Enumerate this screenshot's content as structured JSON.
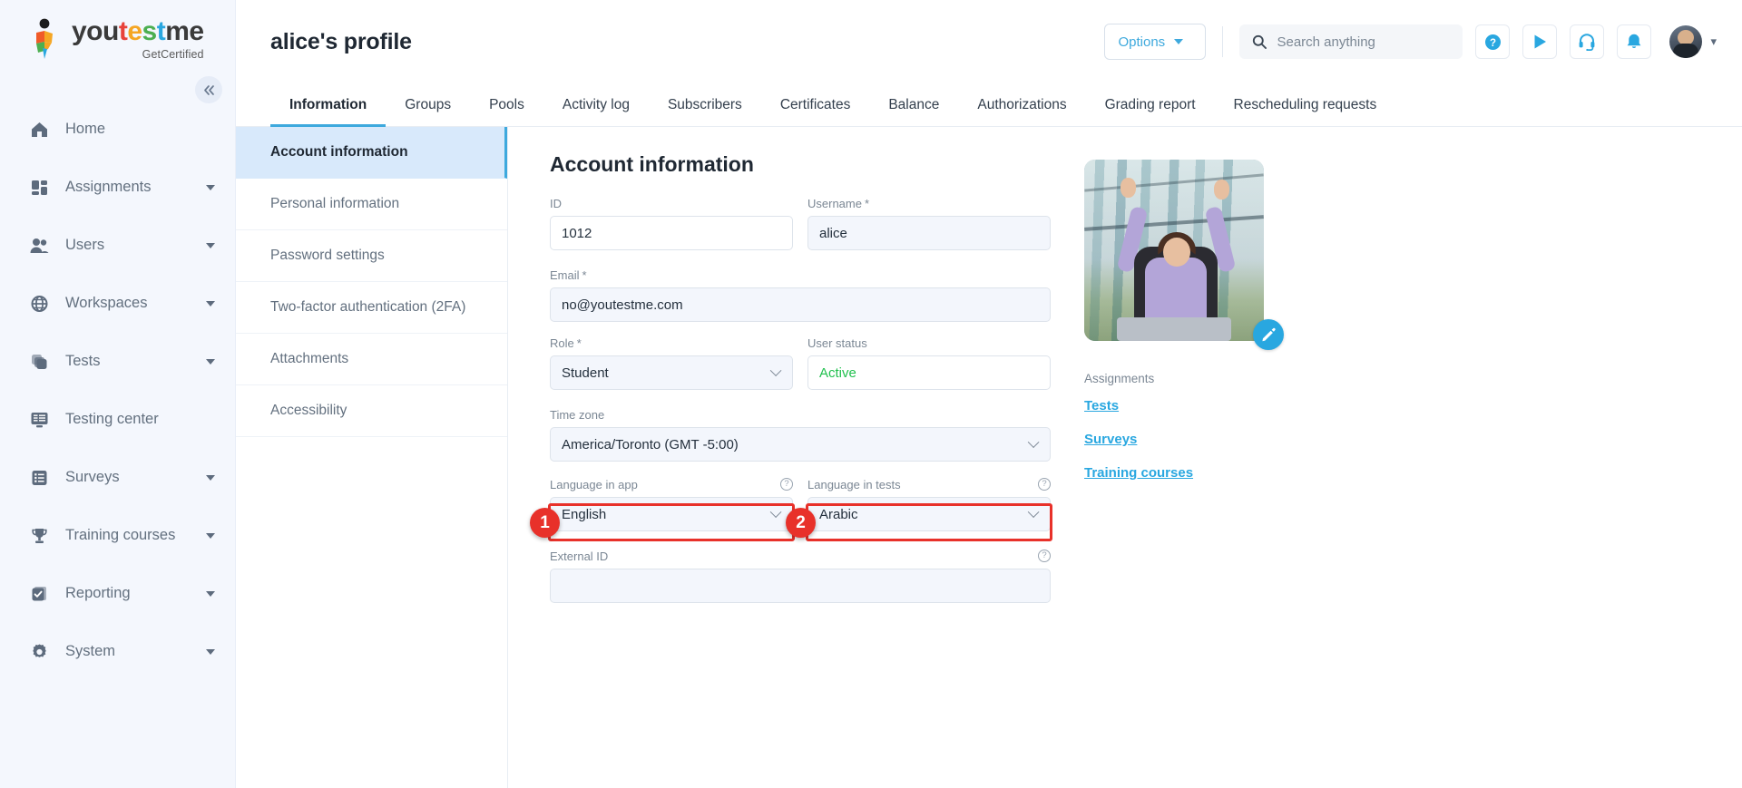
{
  "brand": {
    "word_parts": [
      "you",
      "t",
      "e",
      "s",
      "t",
      "m",
      "e"
    ],
    "name": "youtestme",
    "tagline": "GetCertified",
    "collapse_icon": "chevron-double-left-icon"
  },
  "sidebar": {
    "items": [
      {
        "label": "Home",
        "icon": "home-icon",
        "has_caret": false
      },
      {
        "label": "Assignments",
        "icon": "grid-icon",
        "has_caret": true
      },
      {
        "label": "Users",
        "icon": "users-icon",
        "has_caret": true
      },
      {
        "label": "Workspaces",
        "icon": "globe-icon",
        "has_caret": true
      },
      {
        "label": "Tests",
        "icon": "layers-icon",
        "has_caret": true
      },
      {
        "label": "Testing center",
        "icon": "monitor-icon",
        "has_caret": false
      },
      {
        "label": "Surveys",
        "icon": "list-icon",
        "has_caret": true
      },
      {
        "label": "Training courses",
        "icon": "trophy-icon",
        "has_caret": true
      },
      {
        "label": "Reporting",
        "icon": "report-check-icon",
        "has_caret": true
      },
      {
        "label": "System",
        "icon": "gear-icon",
        "has_caret": true
      }
    ]
  },
  "header": {
    "title": "alice's profile",
    "options_label": "Options",
    "search_placeholder": "Search anything",
    "icons": [
      "help-icon",
      "play-icon",
      "headset-icon",
      "bell-icon"
    ],
    "avatar": "user-avatar"
  },
  "tabs": [
    {
      "label": "Information",
      "active": true
    },
    {
      "label": "Groups",
      "active": false
    },
    {
      "label": "Pools",
      "active": false
    },
    {
      "label": "Activity log",
      "active": false
    },
    {
      "label": "Subscribers",
      "active": false
    },
    {
      "label": "Certificates",
      "active": false
    },
    {
      "label": "Balance",
      "active": false
    },
    {
      "label": "Authorizations",
      "active": false
    },
    {
      "label": "Grading report",
      "active": false
    },
    {
      "label": "Rescheduling requests",
      "active": false
    }
  ],
  "subnav": [
    {
      "label": "Account information",
      "active": true
    },
    {
      "label": "Personal information",
      "active": false
    },
    {
      "label": "Password settings",
      "active": false
    },
    {
      "label": "Two-factor authentication (2FA)",
      "active": false
    },
    {
      "label": "Attachments",
      "active": false
    },
    {
      "label": "Accessibility",
      "active": false
    }
  ],
  "form": {
    "section_title": "Account information",
    "id": {
      "label": "ID",
      "value": "1012"
    },
    "username": {
      "label": "Username",
      "required": "*",
      "value": "alice"
    },
    "email": {
      "label": "Email",
      "required": "*",
      "value": "no@youtestme.com"
    },
    "role": {
      "label": "Role",
      "required": "*",
      "value": "Student"
    },
    "user_status": {
      "label": "User status",
      "value": "Active",
      "color": "#21c04e"
    },
    "time_zone": {
      "label": "Time zone",
      "value": "America/Toronto (GMT -5:00)"
    },
    "language_in_app": {
      "label": "Language in app",
      "value": "English"
    },
    "language_in_tests": {
      "label": "Language in tests",
      "value": "Arabic"
    },
    "external_id": {
      "label": "External ID",
      "value": ""
    }
  },
  "side_panel": {
    "edit_photo_icon": "pencil-icon",
    "assignments_label": "Assignments",
    "links": [
      "Tests",
      "Surveys",
      "Training courses"
    ]
  },
  "annotations": {
    "badges": [
      {
        "number": "1",
        "target": "language-in-app-select"
      },
      {
        "number": "2",
        "target": "language-in-tests-select"
      }
    ],
    "highlight_color": "#e8312a"
  },
  "colors": {
    "accent": "#29a7e0",
    "sidebar_bg": "#f4f7fd",
    "active_subnav_bg": "#d8e9fb",
    "status_green": "#21c04e",
    "annotation_red": "#e8312a"
  }
}
